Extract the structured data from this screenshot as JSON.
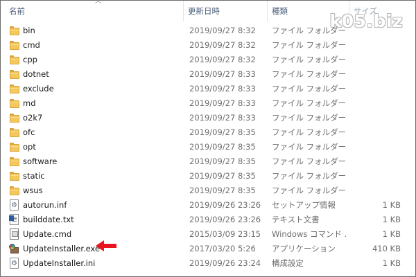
{
  "columns": {
    "name": "名前",
    "date": "更新日時",
    "type": "種類",
    "size": "サイズ"
  },
  "watermark": "k05.biz",
  "files": [
    {
      "name": "bin",
      "date": "2019/09/27 8:32",
      "type": "ファイル フォルダー",
      "size": "",
      "icon": "folder-icon"
    },
    {
      "name": "cmd",
      "date": "2019/09/27 8:32",
      "type": "ファイル フォルダー",
      "size": "",
      "icon": "folder-icon"
    },
    {
      "name": "cpp",
      "date": "2019/09/27 8:32",
      "type": "ファイル フォルダー",
      "size": "",
      "icon": "folder-icon"
    },
    {
      "name": "dotnet",
      "date": "2019/09/27 8:33",
      "type": "ファイル フォルダー",
      "size": "",
      "icon": "folder-icon"
    },
    {
      "name": "exclude",
      "date": "2019/09/27 8:33",
      "type": "ファイル フォルダー",
      "size": "",
      "icon": "folder-icon"
    },
    {
      "name": "md",
      "date": "2019/09/27 8:33",
      "type": "ファイル フォルダー",
      "size": "",
      "icon": "folder-icon"
    },
    {
      "name": "o2k7",
      "date": "2019/09/27 8:33",
      "type": "ファイル フォルダー",
      "size": "",
      "icon": "folder-icon"
    },
    {
      "name": "ofc",
      "date": "2019/09/27 8:35",
      "type": "ファイル フォルダー",
      "size": "",
      "icon": "folder-icon"
    },
    {
      "name": "opt",
      "date": "2019/09/27 8:35",
      "type": "ファイル フォルダー",
      "size": "",
      "icon": "folder-icon"
    },
    {
      "name": "software",
      "date": "2019/09/27 8:35",
      "type": "ファイル フォルダー",
      "size": "",
      "icon": "folder-icon"
    },
    {
      "name": "static",
      "date": "2019/09/27 8:35",
      "type": "ファイル フォルダー",
      "size": "",
      "icon": "folder-icon"
    },
    {
      "name": "wsus",
      "date": "2019/09/27 8:35",
      "type": "ファイル フォルダー",
      "size": "",
      "icon": "folder-icon"
    },
    {
      "name": "autorun.inf",
      "date": "2019/09/26 23:26",
      "type": "セットアップ情報",
      "size": "1 KB",
      "icon": "settings-file-icon"
    },
    {
      "name": "builddate.txt",
      "date": "2019/09/26 23:26",
      "type": "テキスト文書",
      "size": "1 KB",
      "icon": "text-file-icon"
    },
    {
      "name": "Update.cmd",
      "date": "2015/03/09 23:15",
      "type": "Windows コマンド ...",
      "size": "1 KB",
      "icon": "command-file-icon"
    },
    {
      "name": "UpdateInstaller.exe",
      "date": "2017/03/20 5:26",
      "type": "アプリケーション",
      "size": "410 KB",
      "icon": "installer-icon"
    },
    {
      "name": "UpdateInstaller.ini",
      "date": "2019/09/26 23:24",
      "type": "構成設定",
      "size": "1 KB",
      "icon": "settings-file-icon"
    }
  ],
  "colors": {
    "header_text": "#4c607a",
    "detail_text": "#6d6d6d",
    "folder": "#f4c85c",
    "annotation_arrow": "#e8141e"
  }
}
